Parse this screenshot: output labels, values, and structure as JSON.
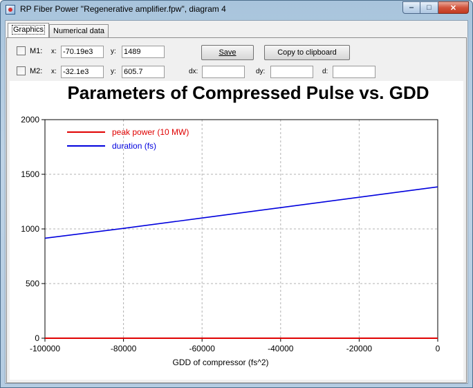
{
  "window": {
    "title": "RP Fiber Power \"Regenerative amplifier.fpw\", diagram 4",
    "minimize_glyph": "‒",
    "maximize_glyph": "□",
    "close_glyph": "✕"
  },
  "tabs": [
    {
      "label": "Graphics",
      "active": true
    },
    {
      "label": "Numerical data",
      "active": false
    }
  ],
  "markers": {
    "m1": {
      "label": "M1:",
      "x_label": "x:",
      "x_value": "-70.19e3",
      "y_label": "y:",
      "y_value": "1489",
      "checked": false
    },
    "m2": {
      "label": "M2:",
      "x_label": "x:",
      "x_value": "-32.1e3",
      "y_label": "y:",
      "y_value": "605.7",
      "checked": false
    }
  },
  "buttons": {
    "save_label": "Save",
    "copy_label": "Copy to clipboard"
  },
  "deltas": {
    "dx_label": "dx:",
    "dx_value": "",
    "dy_label": "dy:",
    "dy_value": "",
    "d_label": "d:",
    "d_value": ""
  },
  "chart_data": {
    "type": "line",
    "title": "Parameters of Compressed Pulse vs. GDD",
    "xlabel": "GDD of compressor (fs^2)",
    "ylabel": "",
    "xlim": [
      -100000,
      0
    ],
    "ylim": [
      0,
      2000
    ],
    "x_ticks": [
      -100000,
      -80000,
      -60000,
      -40000,
      -20000,
      0
    ],
    "y_ticks": [
      0,
      500,
      1000,
      1500,
      2000
    ],
    "x_tick_labels": [
      "-100000",
      "-80000",
      "-60000",
      "-40000",
      "-20000",
      "0"
    ],
    "y_tick_labels": [
      "0",
      "500",
      "1000",
      "1500",
      "2000"
    ],
    "grid": true,
    "legend_position": "top-left",
    "series": [
      {
        "name": "peak power (10 MW)",
        "color": "#e00000",
        "x": [
          -100000,
          -80000,
          -60000,
          -40000,
          -20000,
          0
        ],
        "y": [
          0,
          0,
          0,
          0,
          0,
          0
        ]
      },
      {
        "name": "duration (fs)",
        "color": "#0000dd",
        "x": [
          -100000,
          -80000,
          -60000,
          -40000,
          -20000,
          0
        ],
        "y": [
          915,
          1005,
          1100,
          1195,
          1290,
          1385
        ]
      }
    ]
  }
}
